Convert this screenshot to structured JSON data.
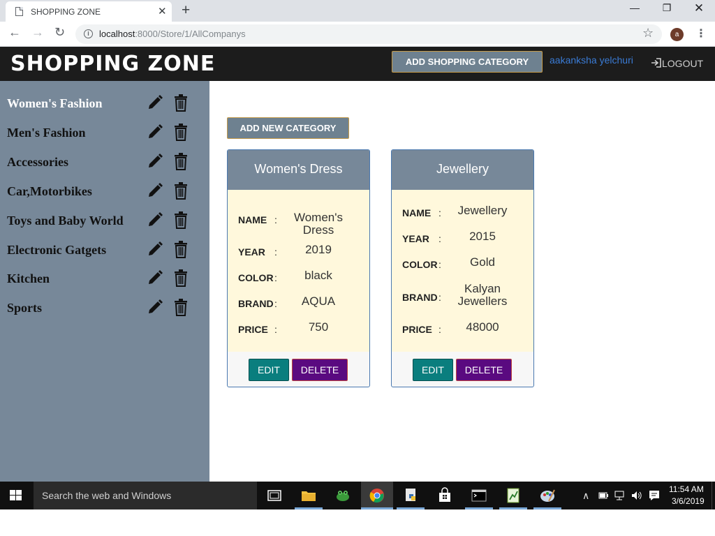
{
  "browser": {
    "tab_title": "SHOPPING ZONE",
    "url_host": "localhost",
    "url_rest": ":8000/Store/1/AllCompanys",
    "profile_initial": "a"
  },
  "header": {
    "brand": "SHOPPING ZONE",
    "add_category_label": "ADD SHOPPING CATEGORY",
    "user_name": "aakanksha yelchuri",
    "logout_label": "LOGOUT"
  },
  "sidebar": {
    "items": [
      {
        "label": "Women's Fashion",
        "active": true
      },
      {
        "label": "Men's Fashion"
      },
      {
        "label": "Accessories"
      },
      {
        "label": "Car,Motorbikes"
      },
      {
        "label": "Toys and Baby World"
      },
      {
        "label": "Electronic Gatgets"
      },
      {
        "label": "Kitchen"
      },
      {
        "label": "Sports"
      }
    ]
  },
  "main": {
    "add_new_category_label": "ADD NEW CATEGORY",
    "labels": {
      "name": "NAME",
      "year": "YEAR",
      "color": "COLOR",
      "brand": "BRAND",
      "price": "PRICE"
    },
    "cards": [
      {
        "title": "Women's Dress",
        "name": "Women's Dress",
        "year": "2019",
        "color": "black",
        "brand": "AQUA",
        "price": "750",
        "edit_label": "EDIT",
        "delete_label": "DELETE"
      },
      {
        "title": "Jewellery",
        "name": "Jewellery",
        "year": "2015",
        "color": "Gold",
        "brand": "Kalyan Jewellers",
        "price": "48000",
        "edit_label": "EDIT",
        "delete_label": "DELETE"
      }
    ]
  },
  "taskbar": {
    "search_placeholder": "Search the web and Windows",
    "time": "11:54 AM",
    "date": "3/6/2019"
  }
}
